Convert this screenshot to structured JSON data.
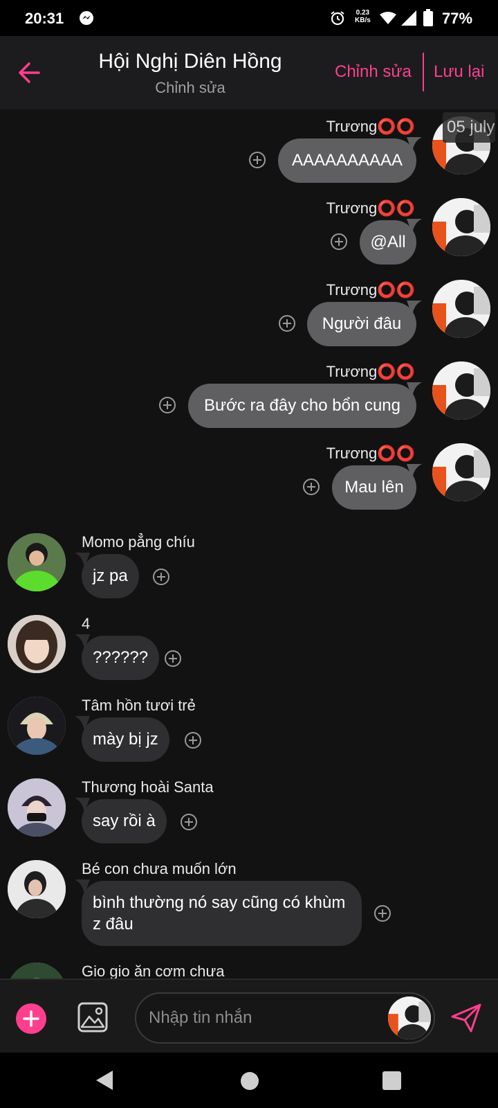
{
  "status_bar": {
    "time": "20:31",
    "net_speed_value": "0.23",
    "net_speed_unit": "KB/s",
    "battery_percent": "77%",
    "icons": [
      "messenger-icon",
      "alarm-icon",
      "wifi-icon",
      "signal-icon",
      "battery-icon"
    ]
  },
  "header": {
    "title": "Hội Nghị Diên Hồng",
    "subtitle": "Chỉnh sửa",
    "edit_label": "Chỉnh sửa",
    "save_label": "Lưu lại",
    "accent_color": "#ff3f8e"
  },
  "date_chip": "05 july",
  "messages": [
    {
      "direction": "out",
      "sender": "Trương⭕⭕",
      "text": "AAAAAAAAAA"
    },
    {
      "direction": "out",
      "sender": "Trương⭕⭕",
      "text": "@All"
    },
    {
      "direction": "out",
      "sender": "Trương⭕⭕",
      "text": "Người đâu"
    },
    {
      "direction": "out",
      "sender": "Trương⭕⭕",
      "text": "Bước ra đây cho bổn cung"
    },
    {
      "direction": "out",
      "sender": "Trương⭕⭕",
      "text": "Mau lên"
    },
    {
      "direction": "in",
      "sender": "Momo pẳng chíu",
      "text": "jz pa"
    },
    {
      "direction": "in",
      "sender": "4",
      "text": "??????"
    },
    {
      "direction": "in",
      "sender": "Tâm hồn tươi trẻ",
      "text": "mày bị jz"
    },
    {
      "direction": "in",
      "sender": "Thương hoài Santa",
      "text": "say rồi à"
    },
    {
      "direction": "in",
      "sender": "Bé con chưa muốn lớn",
      "text": "bình thường nó say cũng có khùm z đâu"
    },
    {
      "direction": "in",
      "sender": "Gio gio ăn cơm chưa",
      "text": ""
    }
  ],
  "composer": {
    "placeholder": "Nhập tin nhắn"
  }
}
